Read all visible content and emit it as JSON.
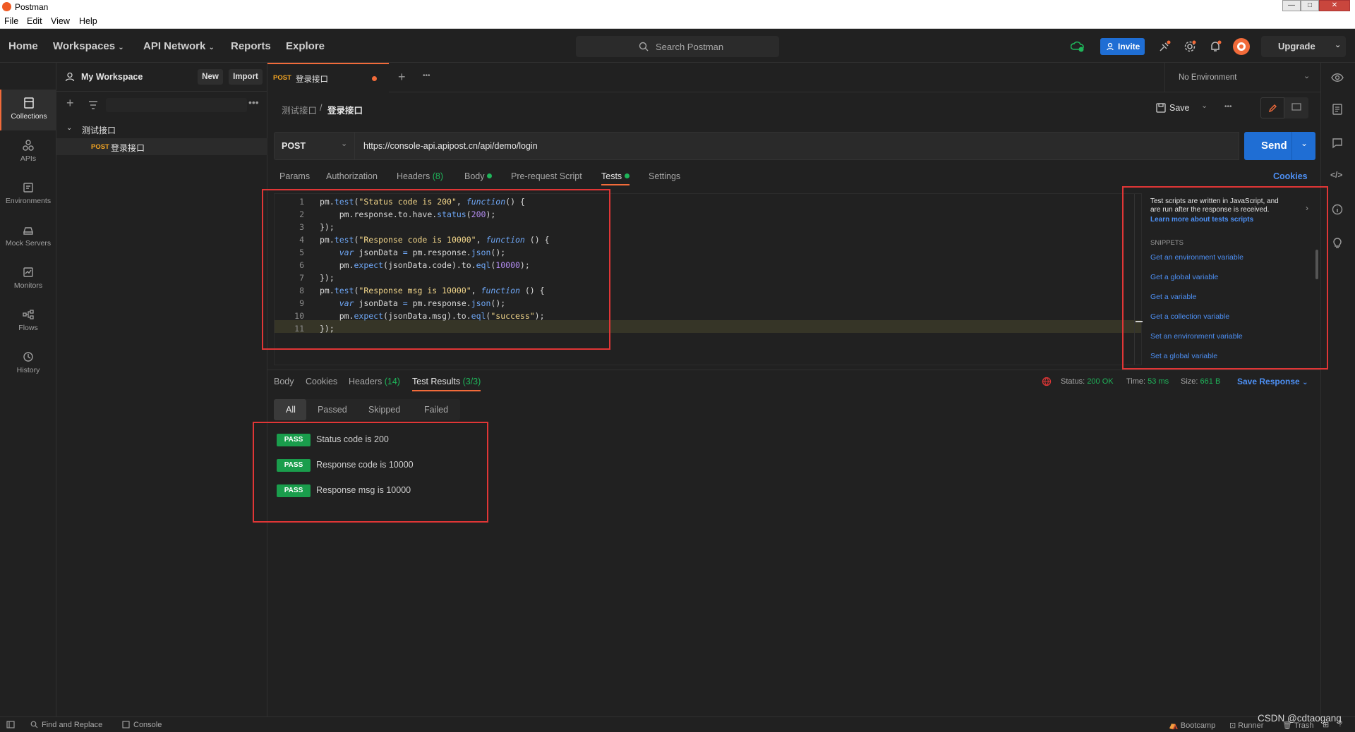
{
  "window": {
    "title": "Postman",
    "min": "—",
    "max": "□",
    "close": "✕"
  },
  "menu": [
    "File",
    "Edit",
    "View",
    "Help"
  ],
  "header": {
    "nav": [
      "Home",
      "Workspaces",
      "API Network",
      "Reports",
      "Explore"
    ],
    "search_placeholder": "Search Postman",
    "invite": "Invite",
    "upgrade": "Upgrade"
  },
  "rail": [
    {
      "label": "Collections",
      "icon": "collections-icon"
    },
    {
      "label": "APIs",
      "icon": "apis-icon"
    },
    {
      "label": "Environments",
      "icon": "environments-icon"
    },
    {
      "label": "Mock Servers",
      "icon": "mock-servers-icon"
    },
    {
      "label": "Monitors",
      "icon": "monitors-icon"
    },
    {
      "label": "Flows",
      "icon": "flows-icon"
    },
    {
      "label": "History",
      "icon": "history-icon"
    }
  ],
  "sidebar": {
    "workspace": "My Workspace",
    "new": "New",
    "import": "Import",
    "collection": "测试接口",
    "request_method": "POST",
    "request_name": "登录接口"
  },
  "tab": {
    "method": "POST",
    "name": "登录接口",
    "environment": "No Environment"
  },
  "breadcrumb": {
    "parent": "测试接口",
    "sep": "/",
    "current": "登录接口",
    "save": "Save"
  },
  "request": {
    "method": "POST",
    "url": "https://console-api.apipost.cn/api/demo/login",
    "send": "Send"
  },
  "req_tabs": {
    "params": "Params",
    "authorization": "Authorization",
    "headers": "Headers",
    "headers_count": "(8)",
    "body": "Body",
    "prerequest": "Pre-request Script",
    "tests": "Tests",
    "settings": "Settings",
    "cookies": "Cookies"
  },
  "code": {
    "line_numbers": [
      "1",
      "2",
      "3",
      "4",
      "5",
      "6",
      "7",
      "8",
      "9",
      "10",
      "11"
    ]
  },
  "snippets": {
    "info": "Test scripts are written in JavaScript, and",
    "info2": "are run after the response is received.",
    "learn": "Learn more about tests scripts",
    "heading": "SNIPPETS",
    "items": [
      "Get an environment variable",
      "Get a global variable",
      "Get a variable",
      "Get a collection variable",
      "Set an environment variable",
      "Set a global variable"
    ]
  },
  "response": {
    "tabs": {
      "body": "Body",
      "cookies": "Cookies",
      "headers": "Headers",
      "headers_count": "(14)",
      "results": "Test Results",
      "results_count": "(3/3)"
    },
    "status_label": "Status:",
    "status": "200 OK",
    "time_label": "Time:",
    "time": "53 ms",
    "size_label": "Size:",
    "size": "661 B",
    "save": "Save Response",
    "filters": [
      "All",
      "Passed",
      "Skipped",
      "Failed"
    ],
    "results": [
      {
        "badge": "PASS",
        "name": "Status code is 200"
      },
      {
        "badge": "PASS",
        "name": "Response code is 10000"
      },
      {
        "badge": "PASS",
        "name": "Response msg is 10000"
      }
    ]
  },
  "statusbar": {
    "find": "Find and Replace",
    "console": "Console",
    "bootcamp": "Bootcamp",
    "runner": "Runner",
    "trash": "Trash",
    "watermark": "CSDN @cdtaogang"
  }
}
